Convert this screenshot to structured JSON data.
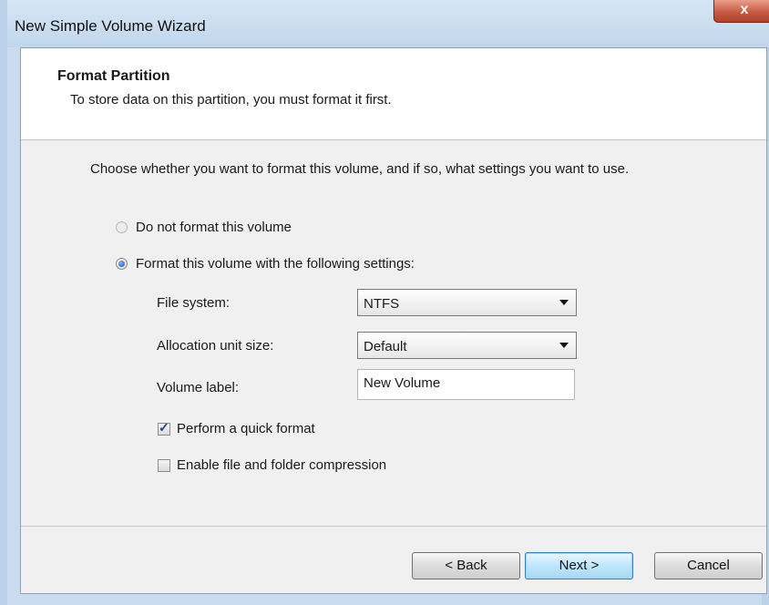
{
  "window": {
    "title": "New Simple Volume Wizard",
    "close_glyph": "x"
  },
  "header": {
    "title": "Format Partition",
    "subtitle": "To store data on this partition, you must format it first."
  },
  "intro": "Choose whether you want to format this volume, and if so, what settings you want to use.",
  "options": {
    "no_format_label": "Do not format this volume",
    "no_format_selected": false,
    "format_label": "Format this volume with the following settings:",
    "format_selected": true
  },
  "settings": {
    "file_system_label": "File system:",
    "file_system_value": "NTFS",
    "allocation_label": "Allocation unit size:",
    "allocation_value": "Default",
    "volume_label_label": "Volume label:",
    "volume_label_value": "New Volume"
  },
  "checkboxes": {
    "quick_format_label": "Perform a quick format",
    "quick_format_checked": true,
    "compression_label": "Enable file and folder compression",
    "compression_checked": false
  },
  "buttons": {
    "back": "< Back",
    "next": "Next >",
    "cancel": "Cancel"
  },
  "colors": {
    "desktop": "#0f2436",
    "frame": "#c9dbee",
    "close_button": "#c75a43",
    "default_button": "#bee6fd"
  }
}
